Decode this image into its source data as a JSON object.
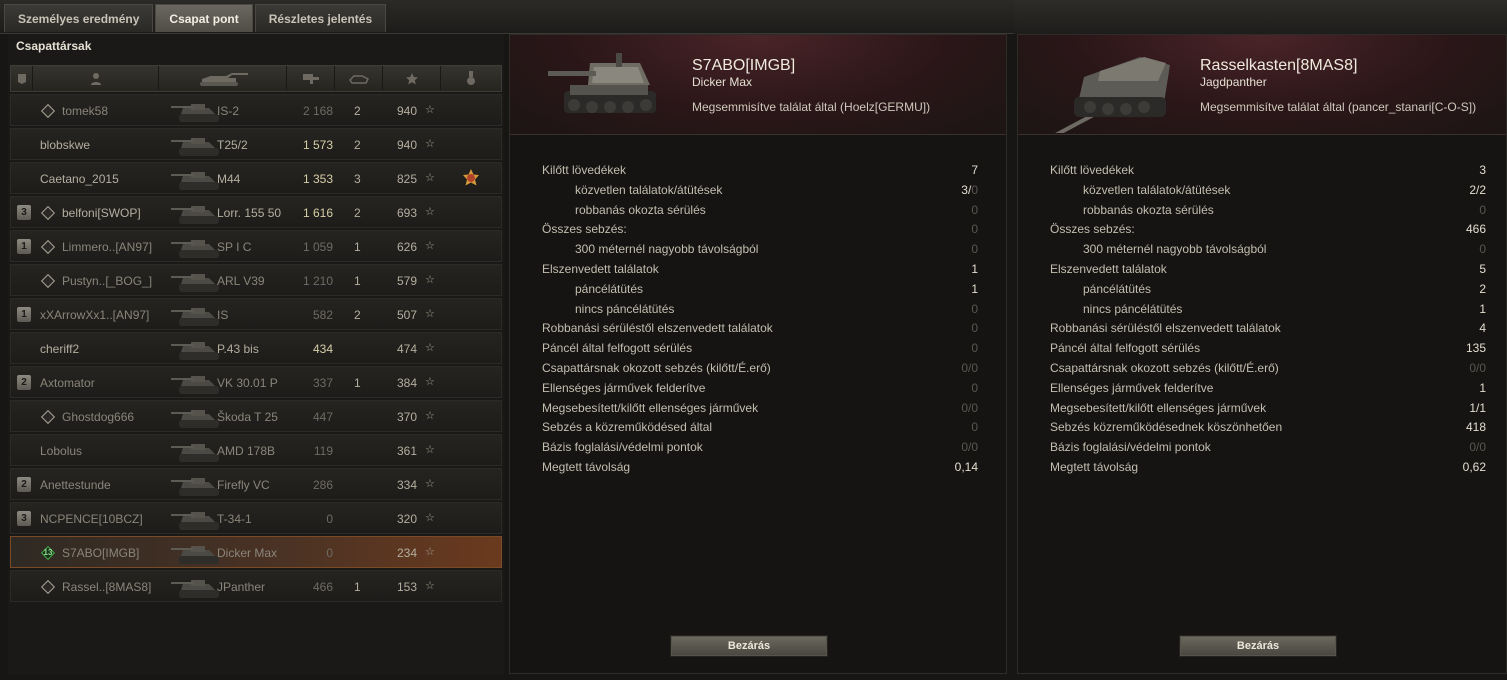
{
  "tabs": [
    "Személyes eredmény",
    "Csapat pont",
    "Részletes jelentés"
  ],
  "active_tab": 1,
  "team": {
    "title": "Csapattársak",
    "columns": [
      "player-icon",
      "tank-icon",
      "damage-icon",
      "kills-icon",
      "xp-star-icon",
      "medal-icon"
    ],
    "rows": [
      {
        "rank": "",
        "tier": "",
        "name": "tomek58",
        "vehicle": "IS-2",
        "damage": "2 168",
        "kills": "2",
        "xp": "940",
        "dead": true,
        "dmg_style": "dim"
      },
      {
        "rank": "",
        "tier": null,
        "name": "blobskwe",
        "vehicle": "T25/2",
        "damage": "1 573",
        "kills": "2",
        "xp": "940",
        "dead": false,
        "dmg_style": "bright"
      },
      {
        "rank": "",
        "tier": null,
        "name": "Caetano_2015",
        "vehicle": "M44",
        "damage": "1 353",
        "kills": "3",
        "xp": "825",
        "dead": false,
        "dmg_style": "bright",
        "medal": true
      },
      {
        "rank": "3",
        "tier": "",
        "name": "belfoni[SWOP]",
        "vehicle": "Lorr. 155 50",
        "damage": "1 616",
        "kills": "2",
        "xp": "693",
        "dead": false,
        "dmg_style": "bright"
      },
      {
        "rank": "1",
        "tier": "",
        "name": "Limmero..[AN97]",
        "vehicle": "SP I C",
        "damage": "1 059",
        "kills": "1",
        "xp": "626",
        "dead": true,
        "dmg_style": "dim"
      },
      {
        "rank": "",
        "tier": "",
        "name": "Pustyn..[_BOG_]",
        "vehicle": "ARL V39",
        "damage": "1 210",
        "kills": "1",
        "xp": "579",
        "dead": true,
        "dmg_style": "dim"
      },
      {
        "rank": "1",
        "tier": null,
        "name": "xXArrowXx1..[AN97]",
        "vehicle": "IS",
        "damage": "582",
        "kills": "2",
        "xp": "507",
        "dead": true,
        "dmg_style": "dim"
      },
      {
        "rank": "",
        "tier": null,
        "name": "cheriff2",
        "vehicle": "P.43 bis",
        "damage": "434",
        "kills": "",
        "xp": "474",
        "dead": false,
        "dmg_style": "bright"
      },
      {
        "rank": "2",
        "tier": null,
        "name": "Axtomator",
        "vehicle": "VK 30.01 P",
        "damage": "337",
        "kills": "1",
        "xp": "384",
        "dead": true,
        "dmg_style": "dim"
      },
      {
        "rank": "",
        "tier": "",
        "name": "Ghostdog666",
        "vehicle": "Škoda T 25",
        "damage": "447",
        "kills": "",
        "xp": "370",
        "dead": true,
        "dmg_style": "dim"
      },
      {
        "rank": "",
        "tier": null,
        "name": "Lobolus",
        "vehicle": "AMD 178B",
        "damage": "119",
        "kills": "",
        "xp": "361",
        "dead": true,
        "dmg_style": "dim"
      },
      {
        "rank": "2",
        "tier": null,
        "name": "Anettestunde",
        "vehicle": "Firefly VC",
        "damage": "286",
        "kills": "",
        "xp": "334",
        "dead": true,
        "dmg_style": "dim"
      },
      {
        "rank": "3",
        "tier": null,
        "name": "NCPENCE[10BCZ]",
        "vehicle": "T-34-1",
        "damage": "0",
        "kills": "",
        "xp": "320",
        "dead": true,
        "dmg_style": "dim"
      },
      {
        "rank": "",
        "tier": "13",
        "name": "S7ABO[IMGB]",
        "vehicle": "Dicker Max",
        "damage": "0",
        "kills": "",
        "xp": "234",
        "dead": true,
        "dmg_style": "dim",
        "highlight": true
      },
      {
        "rank": "",
        "tier": "",
        "name": "Rassel..[8MAS8]",
        "vehicle": "JPanther",
        "damage": "466",
        "kills": "1",
        "xp": "153",
        "dead": true,
        "dmg_style": "dim"
      }
    ]
  },
  "detail_left": {
    "player": "S7ABO[IMGB]",
    "vehicle": "Dicker Max",
    "destroyed_by": "Megsemmisítve találat által (Hoelz[GERMU])",
    "close_label": "Bezárás",
    "stats": [
      {
        "label": "Kilőtt lövedékek",
        "value": "7",
        "sub": false,
        "dim": false
      },
      {
        "label": "közvetlen találatok/átütések",
        "value": "3/",
        "value_dim": "0",
        "sub": true,
        "dim": false
      },
      {
        "label": "robbanás okozta sérülés",
        "value": "0",
        "sub": true,
        "dim": true
      },
      {
        "label": "Összes sebzés:",
        "value": "0",
        "sub": false,
        "dim": true
      },
      {
        "label": "300 méternél nagyobb távolságból",
        "value": "0",
        "sub": true,
        "dim": true
      },
      {
        "label": "Elszenvedett találatok",
        "value": "1",
        "sub": false,
        "dim": false
      },
      {
        "label": "páncélátütés",
        "value": "1",
        "sub": true,
        "dim": false
      },
      {
        "label": "nincs páncélátütés",
        "value": "0",
        "sub": true,
        "dim": true
      },
      {
        "label": "Robbanási sérüléstől elszenvedett találatok",
        "value": "0",
        "sub": false,
        "dim": true
      },
      {
        "label": "Páncél által felfogott sérülés",
        "value": "0",
        "sub": false,
        "dim": true
      },
      {
        "label": "Csapattársnak okozott sebzés (kilőtt/É.erő)",
        "value": "0/0",
        "sub": false,
        "dim": true
      },
      {
        "label": "Ellenséges járművek felderítve",
        "value": "0",
        "sub": false,
        "dim": true
      },
      {
        "label": "Megsebesített/kilőtt ellenséges járművek",
        "value": "0/0",
        "sub": false,
        "dim": true
      },
      {
        "label": "Sebzés a közreműködésed által",
        "value": "0",
        "sub": false,
        "dim": true
      },
      {
        "label": "Bázis foglalási/védelmi pontok",
        "value": "0/0",
        "sub": false,
        "dim": true
      },
      {
        "label": "Megtett távolság",
        "value": "0,14",
        "sub": false,
        "dim": false
      }
    ]
  },
  "detail_right": {
    "player": "Rasselkasten[8MAS8]",
    "vehicle": "Jagdpanther",
    "destroyed_by": "Megsemmisítve találat által (pancer_stanari[C-O-S])",
    "close_label": "Bezárás",
    "stats": [
      {
        "label": "Kilőtt lövedékek",
        "value": "3",
        "sub": false,
        "dim": false
      },
      {
        "label": "közvetlen találatok/átütések",
        "value": "2/2",
        "sub": true,
        "dim": false
      },
      {
        "label": "robbanás okozta sérülés",
        "value": "0",
        "sub": true,
        "dim": true
      },
      {
        "label": "Összes sebzés:",
        "value": "466",
        "sub": false,
        "dim": false
      },
      {
        "label": "300 méternél nagyobb távolságból",
        "value": "0",
        "sub": true,
        "dim": true
      },
      {
        "label": "Elszenvedett találatok",
        "value": "5",
        "sub": false,
        "dim": false
      },
      {
        "label": "páncélátütés",
        "value": "2",
        "sub": true,
        "dim": false
      },
      {
        "label": "nincs páncélátütés",
        "value": "1",
        "sub": true,
        "dim": false
      },
      {
        "label": "Robbanási sérüléstől elszenvedett találatok",
        "value": "4",
        "sub": false,
        "dim": false
      },
      {
        "label": "Páncél által felfogott sérülés",
        "value": "135",
        "sub": false,
        "dim": false
      },
      {
        "label": "Csapattársnak okozott sebzés (kilőtt/É.erő)",
        "value": "0/0",
        "sub": false,
        "dim": true
      },
      {
        "label": "Ellenséges járművek felderítve",
        "value": "1",
        "sub": false,
        "dim": false
      },
      {
        "label": "Megsebesített/kilőtt ellenséges járművek",
        "value": "1/1",
        "sub": false,
        "dim": false
      },
      {
        "label": "Sebzés közreműködésednek köszönhetően",
        "value": "418",
        "sub": false,
        "dim": false
      },
      {
        "label": "Bázis foglalási/védelmi pontok",
        "value": "0/0",
        "sub": false,
        "dim": true
      },
      {
        "label": "Megtett távolság",
        "value": "0,62",
        "sub": false,
        "dim": false
      }
    ]
  }
}
